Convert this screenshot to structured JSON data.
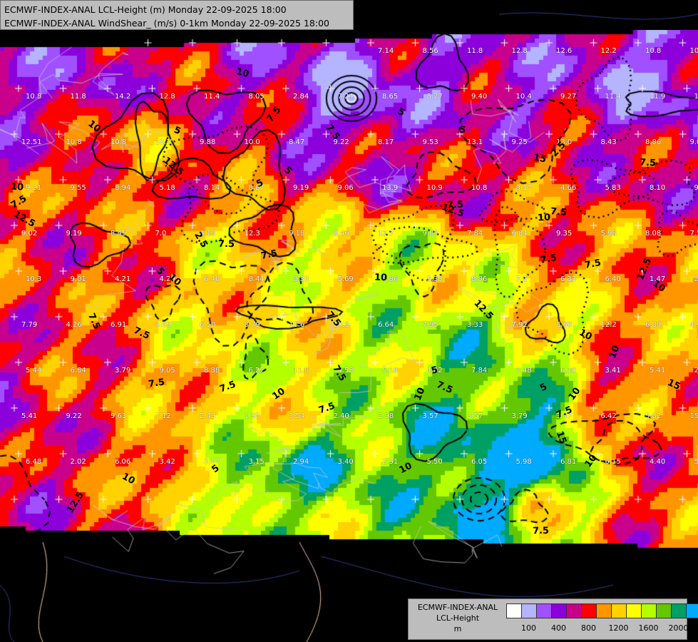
{
  "header": {
    "line1": "ECMWF-INDEX-ANAL LCL-Height (m) Monday 22-09-2025 18:00",
    "line2": "ECMWF-INDEX-ANAL WindShear_ (m/s) 0-1km Monday 22-09-2025 18:00"
  },
  "legend": {
    "title_line1": "ECMWF-INDEX-ANAL",
    "title_line2": "LCL-Height",
    "unit": "m",
    "colors": [
      "#ffffff",
      "#b4b4ff",
      "#a050ff",
      "#8c00dc",
      "#c8008c",
      "#ff0000",
      "#ff9600",
      "#ffd200",
      "#ffff00",
      "#b4ff00",
      "#64c800",
      "#00a064",
      "#00aaff"
    ],
    "tick_labels": [
      {
        "label": "100",
        "index": 1
      },
      {
        "label": "400",
        "index": 3
      },
      {
        "label": "800",
        "index": 5
      },
      {
        "label": "1200",
        "index": 7
      },
      {
        "label": "1600",
        "index": 9
      },
      {
        "label": "2000",
        "index": 11
      }
    ]
  },
  "contour_labels": [
    "12.5",
    "15",
    "10",
    "7.5",
    "15",
    "12.5",
    "10",
    "7.5",
    "2.5",
    "7.5",
    "2.5",
    "7.5",
    "10",
    "5",
    "7.5",
    "10",
    "5",
    "10",
    "7.5",
    "12.5",
    "5",
    "7.5",
    "5",
    "7.5",
    "10",
    "10",
    "7.5",
    "7.5",
    "10",
    "5",
    "5",
    "7.5",
    "7.5",
    "10",
    "12.5",
    "10",
    "5",
    "7.5",
    "12.5",
    "15",
    "10",
    "10",
    "7.5",
    "7.5",
    "5",
    "7.5",
    "7.5",
    "5",
    "7.5",
    "12.5",
    "10",
    "7.5",
    "10",
    "7.5",
    "10"
  ],
  "station_values": [
    "7.14",
    "8.56",
    "11.8",
    "12.8",
    "12.6",
    "12.2",
    "10.8",
    "10.0",
    "10.8",
    "11.8",
    "14.2",
    "12.8",
    "11.4",
    "8.05",
    "2.84",
    "7.24",
    "8.65",
    "8.27",
    "9.40",
    "10.4",
    "9.27",
    "11.4",
    "11.9",
    "12.2",
    "12.51",
    "10.8",
    "10.8",
    "10.2",
    "9.88",
    "10.0",
    "8.47",
    "9.22",
    "8.17",
    "9.53",
    "13.1",
    "9.25",
    "13.0",
    "8.43",
    "8.86",
    "9.09",
    "9.21",
    "9.55",
    "8.94",
    "5.18",
    "8.14",
    "8.87",
    "9.19",
    "9.06",
    "13.9",
    "10.9",
    "10.8",
    "8.17",
    "4.66",
    "5.83",
    "8.10",
    "9.44",
    "9.02",
    "9.19",
    "8.45",
    "7.0",
    "4.10",
    "12.3",
    "9.18",
    "8.46",
    "12.7",
    "9.07",
    "7.84",
    "6.84",
    "9.35",
    "5.98",
    "8.08",
    "7.58",
    "10.3",
    "9.01",
    "4.21",
    "4.29",
    "6.40",
    "8.44",
    "8.33",
    "5.69",
    "8.86",
    "5.33",
    "8.86",
    "7.2",
    "6.33",
    "6.40",
    "1.47",
    "2.84",
    "7.79",
    "4.26",
    "6.91",
    "4.68",
    "6.50",
    "8.79",
    "11.6",
    "10.3",
    "6.64",
    "7.95",
    "3.33",
    "7.92",
    "8.60",
    "12.2",
    "6.89",
    "4.97",
    "5.44",
    "6.84",
    "3.79",
    "9.05",
    "8.88",
    "6.22",
    "11.8",
    "4.53",
    "5.18",
    "4.02",
    "7.84",
    "7.48",
    "6.10",
    "3.41",
    "5.41",
    "2.49",
    "5.41",
    "9.22",
    "9.63",
    "7.12",
    "2.43",
    "1.95",
    "3.54",
    "2.40",
    "2.98",
    "3.57",
    "3.57",
    "3.79",
    "3.47",
    "6.42",
    "5.82",
    "15.6",
    "6.48",
    "2.02",
    "6.06",
    "3.42",
    "3.17",
    "3.15",
    "2.94",
    "3.40",
    "2.31",
    "5.50",
    "6.05",
    "5.98",
    "6.81",
    "6.15",
    "4.40",
    "5.15"
  ]
}
